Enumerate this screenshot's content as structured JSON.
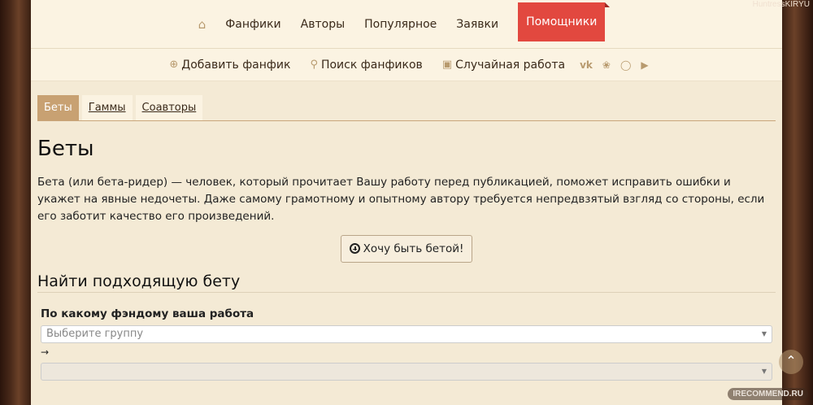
{
  "watermarks": {
    "top": "HuntressKIRYU",
    "bottom": "IRECOMMEND.RU"
  },
  "topnav": {
    "home_icon": "home-icon",
    "items": [
      "Фанфики",
      "Авторы",
      "Популярное",
      "Заявки"
    ],
    "active": "Помощники",
    "active_color": "#e2483f"
  },
  "subnav": {
    "add": "Добавить фанфик",
    "search": "Поиск фанфиков",
    "random": "Случайная работа",
    "social": [
      "vk-icon",
      "twitter-icon",
      "instagram-icon",
      "youtube-icon"
    ]
  },
  "tabs": [
    {
      "label": "Беты",
      "active": true
    },
    {
      "label": "Гаммы",
      "active": false
    },
    {
      "label": "Соавторы",
      "active": false
    }
  ],
  "main": {
    "title": "Беты",
    "description": "Бета (или бета-ридер) — человек, который прочитает Вашу работу перед публикацией, поможет исправить ошибки и укажет на явные недочеты. Даже самому грамотному и опытному автору требуется непредвзятый взгляд со стороны, если его заботит качество его произведений.",
    "become_beta_button": "Хочу быть бетой!",
    "find_title": "Найти подходящую бету",
    "fandom_label": "По какому фэндому ваша работа",
    "group_placeholder": "Выберите группу",
    "arrow": "→",
    "fandom_select_value": ""
  }
}
